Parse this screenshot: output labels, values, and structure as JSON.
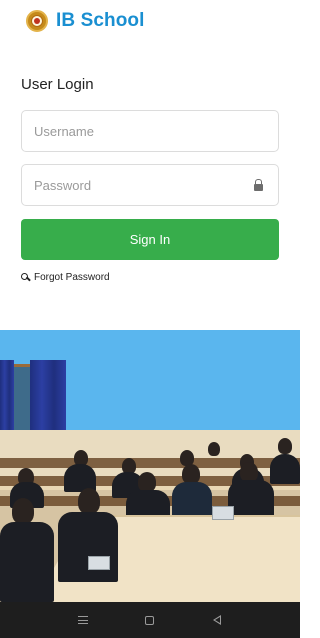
{
  "app": {
    "brand_name": "IB School"
  },
  "login": {
    "title": "User Login",
    "username_placeholder": "Username",
    "password_placeholder": "Password",
    "sign_in_label": "Sign In",
    "forgot_password_label": "Forgot Password"
  },
  "icons": {
    "logo": "school-logo",
    "username": "envelope-icon",
    "password": "lock-icon",
    "forgot": "key-icon"
  },
  "colors": {
    "brand": "#1a8fd1",
    "primary_button": "#37ad4b",
    "navbar": "#1e1e1e"
  },
  "navbar": {
    "buttons": [
      "menu",
      "home",
      "back"
    ]
  }
}
